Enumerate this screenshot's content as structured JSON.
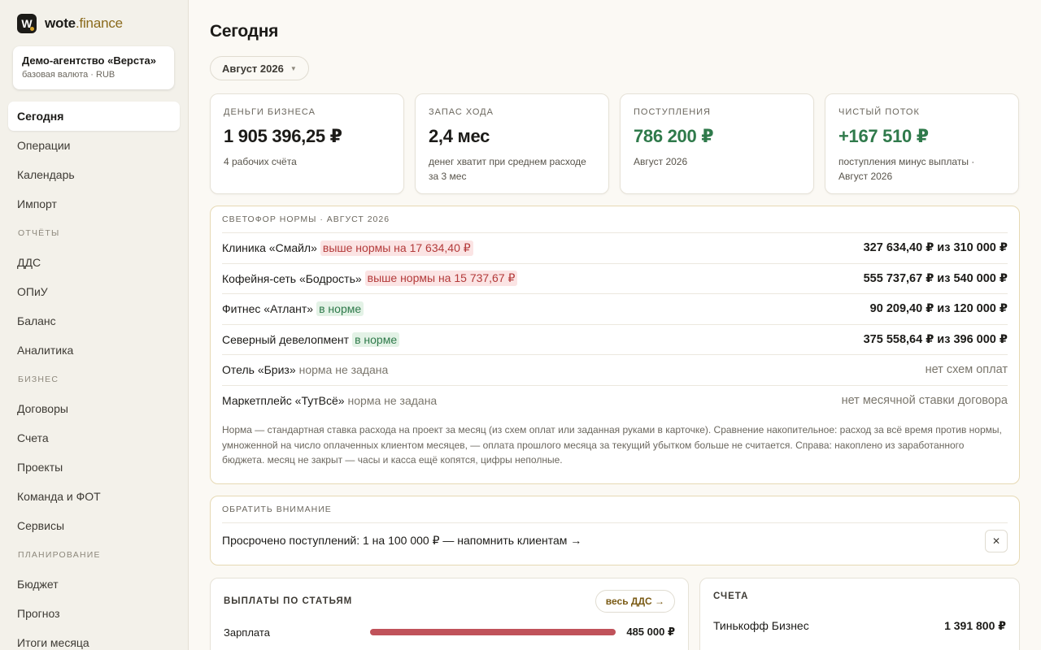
{
  "brand": {
    "logo_letter": "W",
    "name_part1": "wote",
    "name_part2": ".finance"
  },
  "org": {
    "name": "Демо-агентство «Верста»",
    "sub": "базовая валюта · RUB"
  },
  "nav": {
    "today": "Сегодня",
    "operations": "Операции",
    "calendar": "Календарь",
    "import": "Импорт",
    "section_reports": "ОТЧЁТЫ",
    "dds": "ДДС",
    "opiu": "ОПиУ",
    "balance": "Баланс",
    "analytics": "Аналитика",
    "section_business": "БИЗНЕС",
    "contracts": "Договоры",
    "invoices": "Счета",
    "projects": "Проекты",
    "team": "Команда и ФОТ",
    "services": "Сервисы",
    "section_planning": "ПЛАНИРОВАНИЕ",
    "budget": "Бюджет",
    "forecast": "Прогноз",
    "month_results": "Итоги месяца"
  },
  "page": {
    "title": "Сегодня",
    "period": "Август 2026"
  },
  "kpis": [
    {
      "label": "ДЕНЬГИ БИЗНЕСА",
      "value": "1 905 396,25 ₽",
      "sub": "4 рабочих счёта"
    },
    {
      "label": "ЗАПАС ХОДА",
      "value": "2,4 мес",
      "sub": "денег хватит при среднем расходе за 3 мес"
    },
    {
      "label": "ПОСТУПЛЕНИЯ",
      "value": "786 200 ₽",
      "sub": "Август 2026"
    },
    {
      "label": "ЧИСТЫЙ ПОТОК",
      "value": "+167 510 ₽",
      "sub": "поступления минус выплаты · Август 2026"
    }
  ],
  "traffic": {
    "title": "СВЕТОФОР НОРМЫ · АВГУСТ 2026",
    "rows": [
      {
        "name": "Клиника «Смайл»",
        "status": "выше нормы на 17 634,40 ₽",
        "value": "327 634,40 ₽ из 310 000 ₽"
      },
      {
        "name": "Кофейня-сеть «Бодрость»",
        "status": "выше нормы на 15 737,67 ₽",
        "value": "555 737,67 ₽ из 540 000 ₽"
      },
      {
        "name": "Фитнес «Атлант»",
        "status": "в норме",
        "value": "90 209,40 ₽ из 120 000 ₽"
      },
      {
        "name": "Северный девелопмент",
        "status": "в норме",
        "value": "375 558,64 ₽ из 396 000 ₽"
      },
      {
        "name": "Отель «Бриз»",
        "status": "норма не задана",
        "value": "нет схем оплат"
      },
      {
        "name": "Маркетплейс «ТутВсё»",
        "status": "норма не задана",
        "value": "нет месячной ставки договора"
      }
    ],
    "note": "Норма — стандартная ставка расхода на проект за месяц (из схем оплат или заданная руками в карточке). Сравнение накопительное: расход за всё время против нормы, умноженной на число оплаченных клиентом месяцев, — оплата прошлого месяца за текущий убытком больше не считается. Справа: накоплено из заработанного бюджета. месяц не закрыт — часы и касса ещё копятся, цифры неполные."
  },
  "attention": {
    "title": "ОБРАТИТЬ ВНИМАНИЕ",
    "text": "Просрочено поступлений: 1 на 100 000 ₽ — напомнить клиентам →",
    "close": "✕"
  },
  "payouts": {
    "title": "ВЫПЛАТЫ ПО СТАТЬЯМ",
    "button": "весь ДДС →",
    "rows": [
      {
        "label": "Зарплата",
        "value": "485 000 ₽",
        "fraction": 1.0
      }
    ]
  },
  "accounts": {
    "title": "СЧЕТА",
    "rows": [
      {
        "name": "Тинькофф Бизнес",
        "value": "1 391 800 ₽"
      }
    ]
  },
  "colors": {
    "accent": "#8a6a1c",
    "green": "#2f7a4b",
    "red": "#b33a3a",
    "bar": "#c0525a"
  }
}
